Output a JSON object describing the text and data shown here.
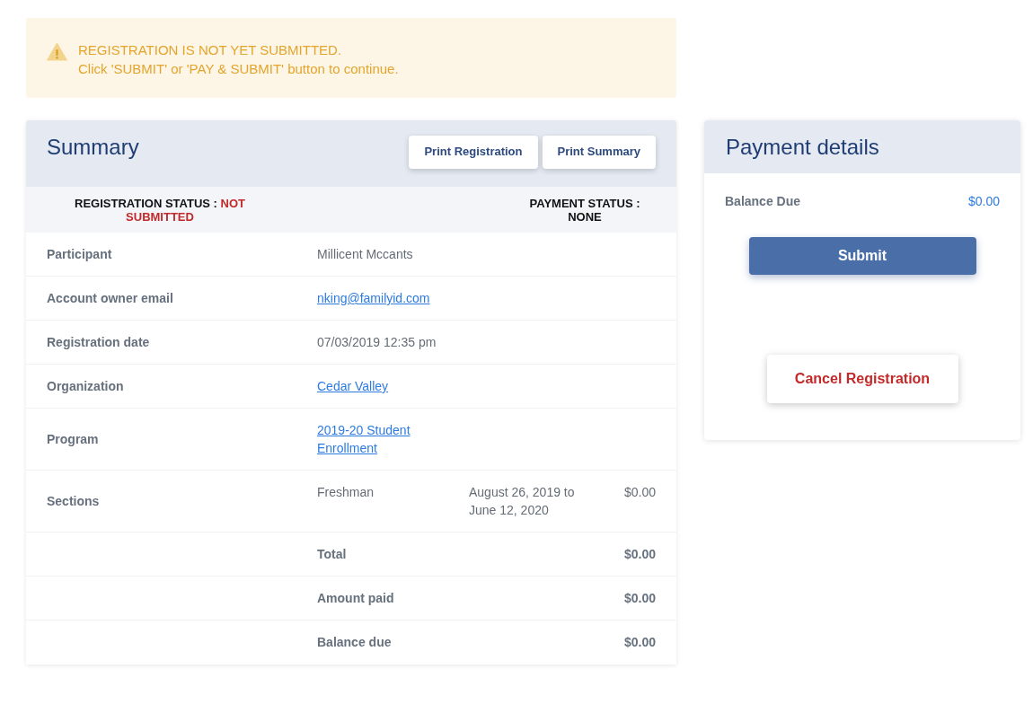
{
  "alert": {
    "lines": [
      "REGISTRATION IS NOT YET SUBMITTED.",
      "Click 'SUBMIT' or 'PAY & SUBMIT' button to continue."
    ]
  },
  "summary": {
    "title": "Summary",
    "buttons": [
      "Print Registration",
      "Print Summary"
    ],
    "registration_status": {
      "label": "REGISTRATION STATUS :",
      "value": "NOT SUBMITTED"
    },
    "payment_status": {
      "label": "PAYMENT STATUS :",
      "value": "NONE"
    },
    "rows": [
      {
        "kind": "text",
        "label": "Participant",
        "value": "Millicent Mccants"
      },
      {
        "kind": "link",
        "label": "Account owner email",
        "value": "nking@familyid.com"
      },
      {
        "kind": "text",
        "label": "Registration date",
        "value": "07/03/2019 12:35 pm"
      },
      {
        "kind": "link",
        "label": "Organization",
        "value": "Cedar Valley"
      },
      {
        "kind": "link",
        "label": "Program",
        "value": "2019-20 Student Enrollment"
      },
      {
        "kind": "section",
        "label": "Sections",
        "name": "Freshman",
        "dates": "August 26, 2019 to June 12, 2020",
        "amount": "$0.00"
      },
      {
        "kind": "total",
        "label": "Total",
        "amount": "$0.00"
      },
      {
        "kind": "total",
        "label": "Amount paid",
        "amount": "$0.00"
      },
      {
        "kind": "total",
        "label": "Balance due",
        "amount": "$0.00"
      }
    ]
  },
  "payment": {
    "title": "Payment details",
    "balance": {
      "label": "Balance Due",
      "value": "$0.00"
    },
    "buttons": [
      {
        "kind": "primary",
        "label": "Submit"
      },
      {
        "kind": "danger",
        "label": "Cancel Registration"
      }
    ]
  }
}
